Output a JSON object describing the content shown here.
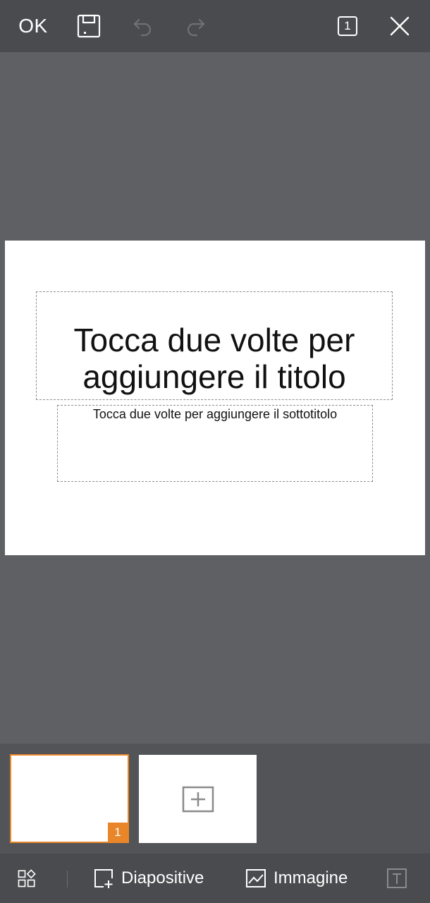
{
  "toolbar": {
    "ok_label": "OK",
    "save_icon": "save-icon",
    "undo_icon": "undo-icon",
    "redo_icon": "redo-icon",
    "page_count": "1",
    "close_icon": "close-icon"
  },
  "slide": {
    "title_placeholder": "Tocca due volte per aggiungere il titolo",
    "subtitle_placeholder": "Tocca due volte per aggiungere il sottotitolo"
  },
  "thumbnails": {
    "items": [
      {
        "number": "1",
        "selected": true
      }
    ],
    "add_icon": "add-slide-icon",
    "accent_color": "#e9862a"
  },
  "bottom_bar": {
    "layout_icon": "layout-grid-icon",
    "slides_label": "Diapositive",
    "image_label": "Immagine",
    "text_icon": "text-box-icon"
  }
}
